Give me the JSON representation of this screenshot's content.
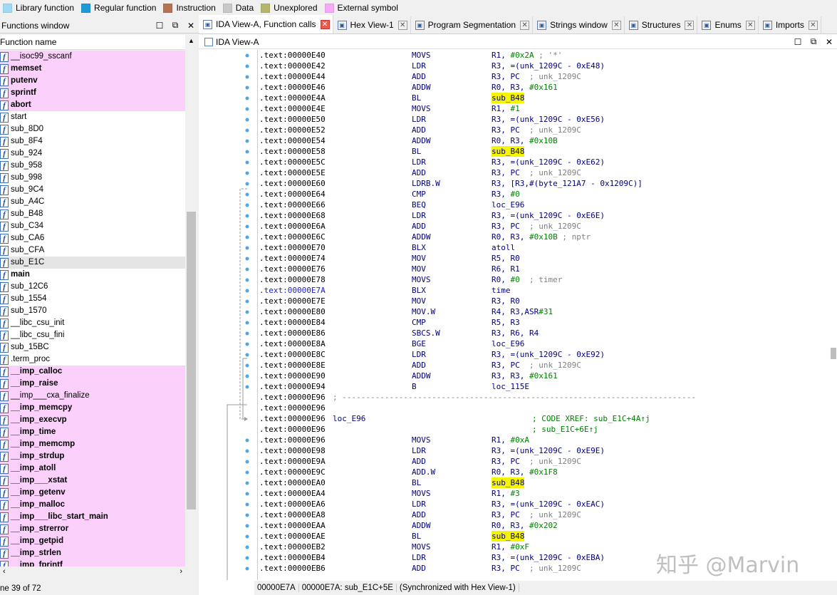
{
  "legend": [
    {
      "label": "Library function",
      "color": "#9fd9f5"
    },
    {
      "label": "Regular function",
      "color": "#1e9bd7"
    },
    {
      "label": "Instruction",
      "color": "#b87251"
    },
    {
      "label": "Data",
      "color": "#c8c8c8"
    },
    {
      "label": "Unexplored",
      "color": "#b5b56c"
    },
    {
      "label": "External symbol",
      "color": "#f8a8f8"
    }
  ],
  "functions_window": {
    "title": "Functions window",
    "column": "Function name",
    "status": "ne 39 of 72",
    "items": [
      {
        "name": "__isoc99_sscanf",
        "kind": "ext"
      },
      {
        "name": "memset",
        "kind": "ext",
        "bold": true
      },
      {
        "name": "putenv",
        "kind": "ext",
        "bold": true
      },
      {
        "name": "sprintf",
        "kind": "ext",
        "bold": true
      },
      {
        "name": "abort",
        "kind": "ext",
        "bold": true
      },
      {
        "name": "start",
        "kind": "reg"
      },
      {
        "name": "sub_8D0",
        "kind": "reg"
      },
      {
        "name": "sub_8F4",
        "kind": "reg"
      },
      {
        "name": "sub_924",
        "kind": "reg"
      },
      {
        "name": "sub_958",
        "kind": "reg"
      },
      {
        "name": "sub_998",
        "kind": "reg"
      },
      {
        "name": "sub_9C4",
        "kind": "reg"
      },
      {
        "name": "sub_A4C",
        "kind": "reg"
      },
      {
        "name": "sub_B48",
        "kind": "reg"
      },
      {
        "name": "sub_C34",
        "kind": "reg"
      },
      {
        "name": "sub_CA6",
        "kind": "reg"
      },
      {
        "name": "sub_CFA",
        "kind": "reg"
      },
      {
        "name": "sub_E1C",
        "kind": "sel"
      },
      {
        "name": "main",
        "kind": "reg",
        "bold": true
      },
      {
        "name": "sub_12C6",
        "kind": "reg"
      },
      {
        "name": "sub_1554",
        "kind": "reg"
      },
      {
        "name": "sub_1570",
        "kind": "reg"
      },
      {
        "name": "__libc_csu_init",
        "kind": "reg"
      },
      {
        "name": "__libc_csu_fini",
        "kind": "reg"
      },
      {
        "name": "sub_15BC",
        "kind": "reg"
      },
      {
        "name": ".term_proc",
        "kind": "reg"
      },
      {
        "name": "__imp_calloc",
        "kind": "ext",
        "bold": true
      },
      {
        "name": "__imp_raise",
        "kind": "ext",
        "bold": true
      },
      {
        "name": "__imp___cxa_finalize",
        "kind": "ext"
      },
      {
        "name": "__imp_memcpy",
        "kind": "ext",
        "bold": true
      },
      {
        "name": "__imp_execvp",
        "kind": "ext",
        "bold": true
      },
      {
        "name": "__imp_time",
        "kind": "ext",
        "bold": true
      },
      {
        "name": "__imp_memcmp",
        "kind": "ext",
        "bold": true
      },
      {
        "name": "__imp_strdup",
        "kind": "ext",
        "bold": true
      },
      {
        "name": "__imp_atoll",
        "kind": "ext",
        "bold": true
      },
      {
        "name": "__imp___xstat",
        "kind": "ext",
        "bold": true
      },
      {
        "name": "__imp_getenv",
        "kind": "ext",
        "bold": true
      },
      {
        "name": "__imp_malloc",
        "kind": "ext",
        "bold": true
      },
      {
        "name": "__imp___libc_start_main",
        "kind": "ext",
        "bold": true
      },
      {
        "name": "__imp_strerror",
        "kind": "ext",
        "bold": true
      },
      {
        "name": "__imp_getpid",
        "kind": "ext",
        "bold": true
      },
      {
        "name": "__imp_strlen",
        "kind": "ext",
        "bold": true
      },
      {
        "name": "__imp_fprintf",
        "kind": "ext",
        "bold": true
      }
    ]
  },
  "tabs": [
    {
      "label": "IDA View-A, Function calls",
      "active": true,
      "icon": "ida-view-icon"
    },
    {
      "label": "Hex View-1",
      "icon": "hex-view-icon"
    },
    {
      "label": "Program Segmentation",
      "icon": "segmentation-icon"
    },
    {
      "label": "Strings window",
      "icon": "strings-icon"
    },
    {
      "label": "Structures",
      "icon": "structures-icon"
    },
    {
      "label": "Enums",
      "icon": "enums-icon"
    },
    {
      "label": "Imports",
      "icon": "imports-icon"
    }
  ],
  "ida_view": {
    "title": "IDA View-A",
    "status": [
      "00000E7A",
      "00000E7A: sub_E1C+5E",
      "(Synchronized with Hex View-1)"
    ],
    "lines": [
      {
        "a": ".text:00000E40",
        "m": "MOVS",
        "o": "R1, #0x2A ; '*'"
      },
      {
        "a": ".text:00000E42",
        "m": "LDR",
        "o": "R3, =(unk_1209C - 0xE48)"
      },
      {
        "a": ".text:00000E44",
        "m": "ADD",
        "o": "R3, PC  ; unk_1209C"
      },
      {
        "a": ".text:00000E46",
        "m": "ADDW",
        "o": "R0, R3, #0x161"
      },
      {
        "a": ".text:00000E4A",
        "m": "BL",
        "o": "sub_B48",
        "hl": true
      },
      {
        "a": ".text:00000E4E",
        "m": "MOVS",
        "o": "R1, #1"
      },
      {
        "a": ".text:00000E50",
        "m": "LDR",
        "o": "R3, =(unk_1209C - 0xE56)"
      },
      {
        "a": ".text:00000E52",
        "m": "ADD",
        "o": "R3, PC  ; unk_1209C"
      },
      {
        "a": ".text:00000E54",
        "m": "ADDW",
        "o": "R0, R3, #0x10B"
      },
      {
        "a": ".text:00000E58",
        "m": "BL",
        "o": "sub_B48",
        "hl": true
      },
      {
        "a": ".text:00000E5C",
        "m": "LDR",
        "o": "R3, =(unk_1209C - 0xE62)"
      },
      {
        "a": ".text:00000E5E",
        "m": "ADD",
        "o": "R3, PC  ; unk_1209C"
      },
      {
        "a": ".text:00000E60",
        "m": "LDRB.W",
        "o": "R3, [R3,#(byte_121A7 - 0x1209C)]"
      },
      {
        "a": ".text:00000E64",
        "m": "CMP",
        "o": "R3, #0"
      },
      {
        "a": ".text:00000E66",
        "m": "BEQ",
        "o": "loc_E96"
      },
      {
        "a": ".text:00000E68",
        "m": "LDR",
        "o": "R3, =(unk_1209C - 0xE6E)"
      },
      {
        "a": ".text:00000E6A",
        "m": "ADD",
        "o": "R3, PC  ; unk_1209C"
      },
      {
        "a": ".text:00000E6C",
        "m": "ADDW",
        "o": "R0, R3, #0x10B ; nptr"
      },
      {
        "a": ".text:00000E70",
        "m": "BLX",
        "o": "atoll"
      },
      {
        "a": ".text:00000E74",
        "m": "MOV",
        "o": "R5, R0"
      },
      {
        "a": ".text:00000E76",
        "m": "MOV",
        "o": "R6, R1"
      },
      {
        "a": ".text:00000E78",
        "m": "MOVS",
        "o": "R0, #0  ; timer"
      },
      {
        "a": ".text:00000E7A",
        "m": "BLX",
        "o": "time",
        "cur": true
      },
      {
        "a": ".text:00000E7E",
        "m": "MOV",
        "o": "R3, R0"
      },
      {
        "a": ".text:00000E80",
        "m": "MOV.W",
        "o": "R4, R3,ASR#31"
      },
      {
        "a": ".text:00000E84",
        "m": "CMP",
        "o": "R5, R3"
      },
      {
        "a": ".text:00000E86",
        "m": "SBCS.W",
        "o": "R3, R6, R4"
      },
      {
        "a": ".text:00000E8A",
        "m": "BGE",
        "o": "loc_E96"
      },
      {
        "a": ".text:00000E8C",
        "m": "LDR",
        "o": "R3, =(unk_1209C - 0xE92)"
      },
      {
        "a": ".text:00000E8E",
        "m": "ADD",
        "o": "R3, PC  ; unk_1209C"
      },
      {
        "a": ".text:00000E90",
        "m": "ADDW",
        "o": "R3, R3, #0x161"
      },
      {
        "a": ".text:00000E94",
        "m": "B",
        "o": "loc_115E"
      },
      {
        "a": ".text:00000E96",
        "sep": "; ---------------------------------------------------------------------------"
      },
      {
        "a": ".text:00000E96"
      },
      {
        "a": ".text:00000E96",
        "label": "loc_E96",
        "xref": "; CODE XREF: sub_E1C+4A↑j"
      },
      {
        "a": ".text:00000E96",
        "xref": "; sub_E1C+6E↑j"
      },
      {
        "a": ".text:00000E96",
        "m": "MOVS",
        "o": "R1, #0xA"
      },
      {
        "a": ".text:00000E98",
        "m": "LDR",
        "o": "R3, =(unk_1209C - 0xE9E)"
      },
      {
        "a": ".text:00000E9A",
        "m": "ADD",
        "o": "R3, PC  ; unk_1209C"
      },
      {
        "a": ".text:00000E9C",
        "m": "ADD.W",
        "o": "R0, R3, #0x1F8"
      },
      {
        "a": ".text:00000EA0",
        "m": "BL",
        "o": "sub_B48",
        "hl": true
      },
      {
        "a": ".text:00000EA4",
        "m": "MOVS",
        "o": "R1, #3"
      },
      {
        "a": ".text:00000EA6",
        "m": "LDR",
        "o": "R3, =(unk_1209C - 0xEAC)"
      },
      {
        "a": ".text:00000EA8",
        "m": "ADD",
        "o": "R3, PC  ; unk_1209C"
      },
      {
        "a": ".text:00000EAA",
        "m": "ADDW",
        "o": "R0, R3, #0x202"
      },
      {
        "a": ".text:00000EAE",
        "m": "BL",
        "o": "sub_B48",
        "hl": true
      },
      {
        "a": ".text:00000EB2",
        "m": "MOVS",
        "o": "R1, #0xF"
      },
      {
        "a": ".text:00000EB4",
        "m": "LDR",
        "o": "R3, =(unk_1209C - 0xEBA)"
      },
      {
        "a": ".text:00000EB6",
        "m": "ADD",
        "o": "R3, PC  ; unk_1209C"
      }
    ]
  },
  "watermark": "知乎 @Marvin"
}
